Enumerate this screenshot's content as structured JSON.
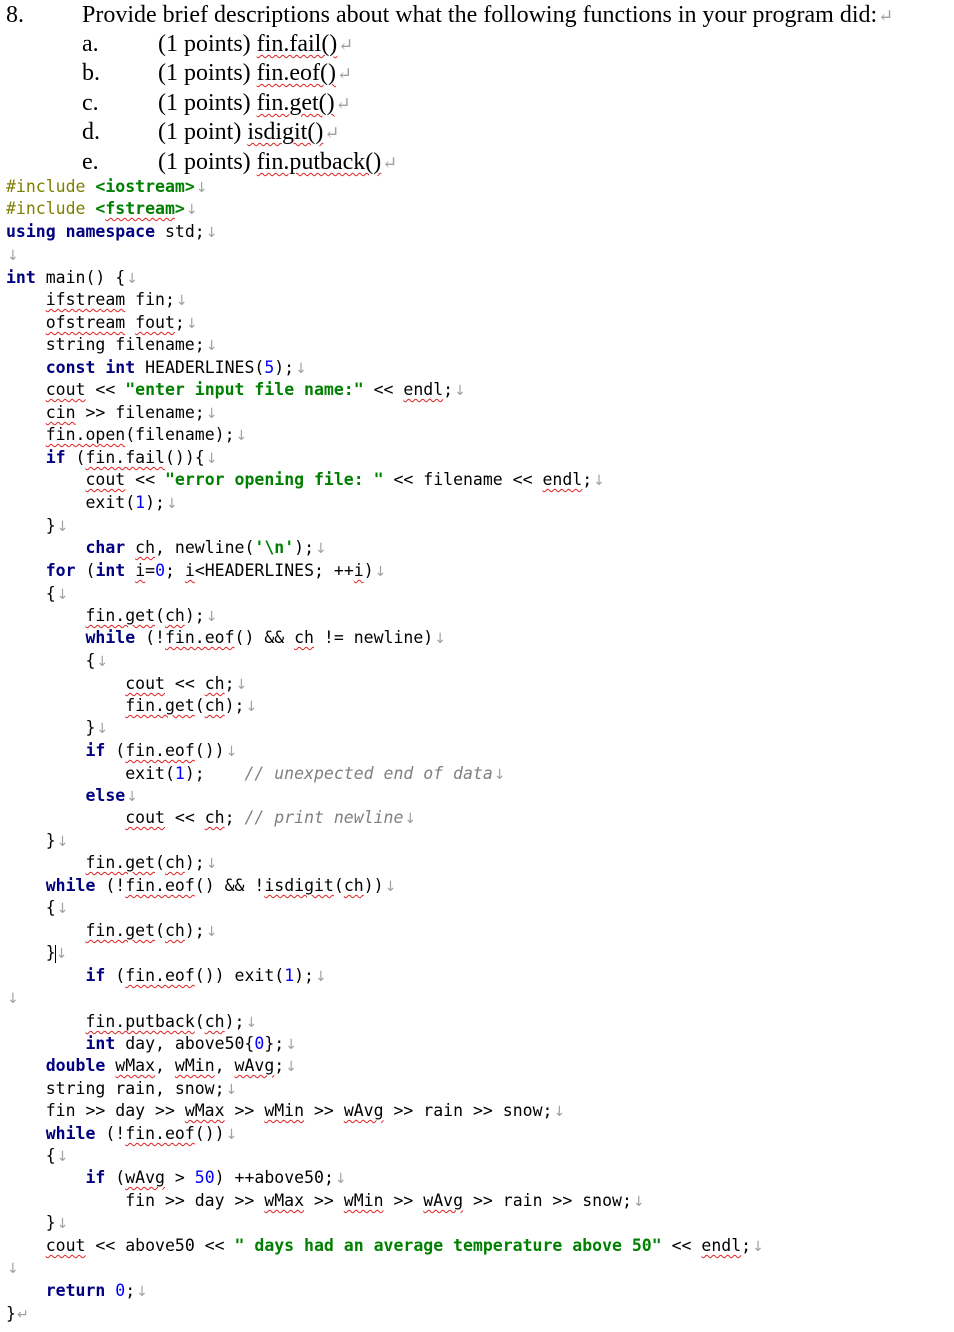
{
  "question": {
    "number": "8.",
    "prompt": "Provide brief descriptions about what the following functions in your program did:",
    "items": [
      {
        "letter": "a.",
        "points": "(1 points)",
        "func": "fin.fail()"
      },
      {
        "letter": "b.",
        "points": "(1 points)",
        "func": "fin.eof()"
      },
      {
        "letter": "c.",
        "points": "(1 points)",
        "func": "fin.get()"
      },
      {
        "letter": "d.",
        "points": "(1 point)",
        "func": "isdigit()"
      },
      {
        "letter": "e.",
        "points": "(1 points)",
        "func": "fin.putback()"
      }
    ]
  },
  "code": {
    "lines": [
      "#include <iostream>",
      "#include <fstream>",
      "using namespace std;",
      "",
      "int main() {",
      "    ifstream fin;",
      "    ofstream fout;",
      "    string filename;",
      "    const int HEADERLINES(5);",
      "    cout << \"enter input file name:\" << endl;",
      "    cin >> filename;",
      "    fin.open(filename);",
      "    if (fin.fail()){",
      "        cout << \"error opening file: \" << filename << endl;",
      "        exit(1);",
      "    }",
      "        char ch, newline('\\n');",
      "    for (int i=0; i<HEADERLINES; ++i)",
      "    {",
      "        fin.get(ch);",
      "        while (!fin.eof() && ch != newline)",
      "        {",
      "            cout << ch;",
      "            fin.get(ch);",
      "        }",
      "        if (fin.eof())",
      "            exit(1);    // unexpected end of data",
      "        else",
      "            cout << ch; // print newline",
      "    }",
      "        fin.get(ch);",
      "    while (!fin.eof() && !isdigit(ch))",
      "    {",
      "        fin.get(ch);",
      "    }",
      "        if (fin.eof()) exit(1);",
      "",
      "        fin.putback(ch);",
      "        int day, above50{0};",
      "    double wMax, wMin, wAvg;",
      "    string rain, snow;",
      "    fin >> day >> wMax >> wMin >> wAvg >> rain >> snow;",
      "    while (!fin.eof())",
      "    {",
      "        if (wAvg > 50) ++above50;",
      "            fin >> day >> wMax >> wMin >> wAvg >> rain >> snow;",
      "    }",
      "    cout << above50 << \" days had an average temperature above 50\" << endl;",
      "",
      "    return 0;",
      "}"
    ]
  },
  "marks": {
    "paragraph": "↵",
    "line_break": "↓"
  },
  "colors": {
    "keyword": "#000080",
    "preprocessor": "#808000",
    "string": "#008000",
    "number": "#0000ff",
    "comment": "#808080",
    "spellcheck": "#e02020"
  }
}
